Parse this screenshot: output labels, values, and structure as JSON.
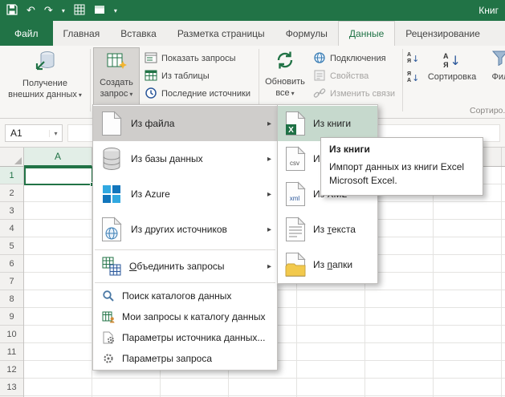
{
  "icons": {
    "caret_down": "▾",
    "submenu_arrow": "▸",
    "undo": "↶",
    "redo": "↷",
    "sort_down_arrow": "↓",
    "name_box_caret": "▾"
  },
  "titlebar": {
    "doc_title": "Книг"
  },
  "tabs": [
    {
      "label": "Файл"
    },
    {
      "label": "Главная"
    },
    {
      "label": "Вставка"
    },
    {
      "label": "Разметка страницы"
    },
    {
      "label": "Формулы"
    },
    {
      "label": "Данные"
    },
    {
      "label": "Рецензирование"
    }
  ],
  "ribbon": {
    "get_external": {
      "line1": "Получение",
      "line2": "внешних данных"
    },
    "new_query": {
      "line1": "Создать",
      "line2": "запрос"
    },
    "show_queries": "Показать запросы",
    "from_table": "Из таблицы",
    "recent_sources": "Последние источники",
    "refresh_all": {
      "line1": "Обновить",
      "line2": "все"
    },
    "connections": "Подключения",
    "properties": "Свойства",
    "edit_links": "Изменить связи",
    "sort": "Сортировка",
    "filter": "Фил",
    "sort_group_label": "Сортиро...",
    "sort_asc_icon": {
      "top": "А",
      "bottom": "Я"
    },
    "sort_desc_icon": {
      "top": "Я",
      "bottom": "А"
    },
    "sort_big_icon": {
      "top": "А",
      "bottom": "Я"
    }
  },
  "formula_bar": {
    "name_box": "A1"
  },
  "sheet": {
    "column_a_header": "A",
    "row_numbers": [
      "1",
      "2",
      "3",
      "4",
      "5",
      "6",
      "7",
      "8",
      "9",
      "10",
      "11",
      "12",
      "13"
    ]
  },
  "menu": {
    "items": [
      {
        "label": "Из файла"
      },
      {
        "label": "Из базы данных"
      },
      {
        "label": "Из Azure"
      },
      {
        "label": "Из других источников"
      },
      {
        "key": "О",
        "post": "бъединить запросы"
      },
      {
        "label": "Поиск каталогов данных"
      },
      {
        "label": "Мои запросы к каталогу данных"
      },
      {
        "label": "Параметры источника данных..."
      },
      {
        "label": "Параметры запроса"
      }
    ]
  },
  "submenu": {
    "items": [
      {
        "label": "Из книги"
      },
      {
        "label": "Из CSV"
      },
      {
        "label": "Из XML"
      },
      {
        "pre": "Из ",
        "key": "т",
        "post": "екста"
      },
      {
        "pre": "Из ",
        "key": "п",
        "post": "апки"
      }
    ]
  },
  "tooltip": {
    "title": "Из книги",
    "body": "Импорт данных из книги Excel Microsoft Excel."
  },
  "colors": {
    "excel_green": "#217346",
    "menu_highlight": "#cfcdcb",
    "submenu_highlight": "#c6d9cd"
  }
}
